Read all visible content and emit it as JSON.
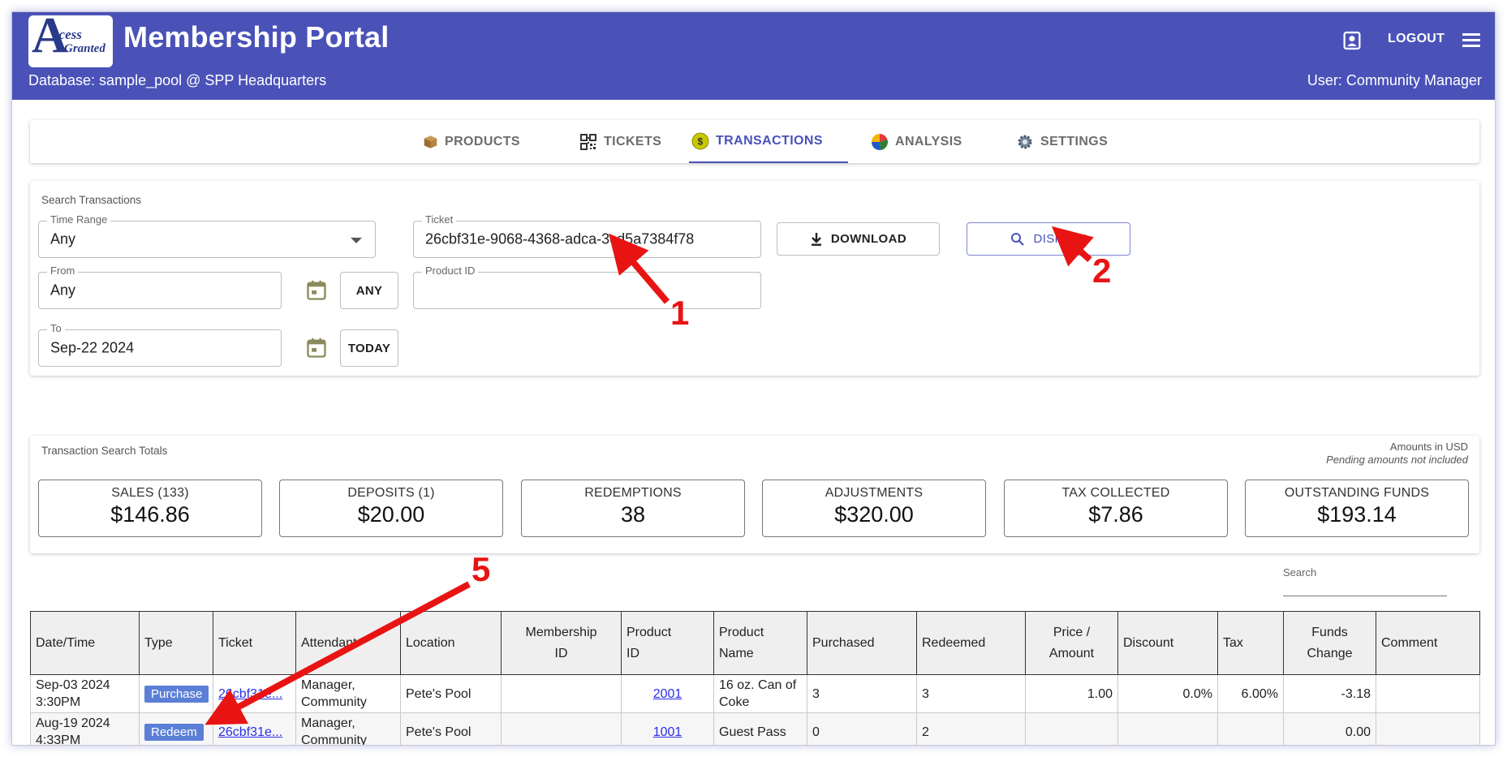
{
  "header": {
    "logo_big": "A",
    "logo_line1": "ccess",
    "logo_line2": "Granted",
    "title": "Membership Portal",
    "database_line": "Database: sample_pool @ SPP Headquarters",
    "user_line": "User: Community Manager",
    "logout_label": "LOGOUT",
    "bar_color": "#4a52b8"
  },
  "tabs": [
    {
      "label": "PRODUCTS",
      "icon": "box-icon"
    },
    {
      "label": "TICKETS",
      "icon": "qr-code-icon"
    },
    {
      "label": "TRANSACTIONS",
      "icon": "dollar-coin-icon",
      "active": true
    },
    {
      "label": "ANALYSIS",
      "icon": "pie-chart-icon"
    },
    {
      "label": "SETTINGS",
      "icon": "gear-icon"
    }
  ],
  "search": {
    "title": "Search Transactions",
    "time_range": {
      "label": "Time Range",
      "value": "Any"
    },
    "ticket": {
      "label": "Ticket",
      "value": "26cbf31e-9068-4368-adca-3cd5a7384f78"
    },
    "product_id": {
      "label": "Product ID",
      "value": ""
    },
    "from": {
      "label": "From",
      "value": "Any",
      "button": "ANY"
    },
    "to": {
      "label": "To",
      "value": "Sep-22 2024",
      "button": "TODAY"
    },
    "download_label": "DOWNLOAD",
    "display_label": "DISPLAY"
  },
  "totals": {
    "title": "Transaction Search Totals",
    "note_line1": "Amounts in USD",
    "note_line2": "Pending amounts not included",
    "boxes": [
      {
        "label": "SALES (133)",
        "value": "$146.86"
      },
      {
        "label": "DEPOSITS (1)",
        "value": "$20.00"
      },
      {
        "label": "REDEMPTIONS",
        "value": "38"
      },
      {
        "label": "ADJUSTMENTS",
        "value": "$320.00"
      },
      {
        "label": "TAX COLLECTED",
        "value": "$7.86"
      },
      {
        "label": "OUTSTANDING FUNDS",
        "value": "$193.14"
      }
    ]
  },
  "table": {
    "search_label": "Search",
    "headers": {
      "datetime": "Date/Time",
      "type": "Type",
      "ticket": "Ticket",
      "attendant": "Attendant",
      "location": "Location",
      "membership_l1": "Membership",
      "membership_l2": "ID",
      "product_id_l1": "Product",
      "product_id_l2": "ID",
      "product_name_l1": "Product",
      "product_name_l2": "Name",
      "purchased": "Purchased",
      "redeemed": "Redeemed",
      "price_l1": "Price /",
      "price_l2": "Amount",
      "discount": "Discount",
      "tax": "Tax",
      "funds_l1": "Funds",
      "funds_l2": "Change",
      "comment": "Comment"
    },
    "rows": [
      {
        "date": "Sep-03 2024",
        "time": "3:30PM",
        "type": "Purchase",
        "ticket": "26cbf31e...",
        "attendant_l1": "Manager,",
        "attendant_l2": "Community",
        "location": "Pete's Pool",
        "membership_id": "",
        "product_id": "2001",
        "product_name_l1": "16 oz. Can of",
        "product_name_l2": "Coke",
        "purchased": "3",
        "redeemed": "3",
        "price": "1.00",
        "discount": "0.0%",
        "tax": "6.00%",
        "funds_change": "-3.18",
        "comment": ""
      },
      {
        "date": "Aug-19 2024",
        "time": "4:33PM",
        "type": "Redeem",
        "ticket": "26cbf31e...",
        "attendant_l1": "Manager,",
        "attendant_l2": "Community",
        "location": "Pete's Pool",
        "membership_id": "",
        "product_id": "1001",
        "product_name_l1": "Guest Pass",
        "product_name_l2": "",
        "purchased": "0",
        "redeemed": "2",
        "price": "",
        "discount": "",
        "tax": "",
        "funds_change": "0.00",
        "comment": ""
      }
    ]
  },
  "annotations": {
    "color": "#e81414",
    "n1": "1",
    "n2": "2",
    "n5": "5"
  }
}
